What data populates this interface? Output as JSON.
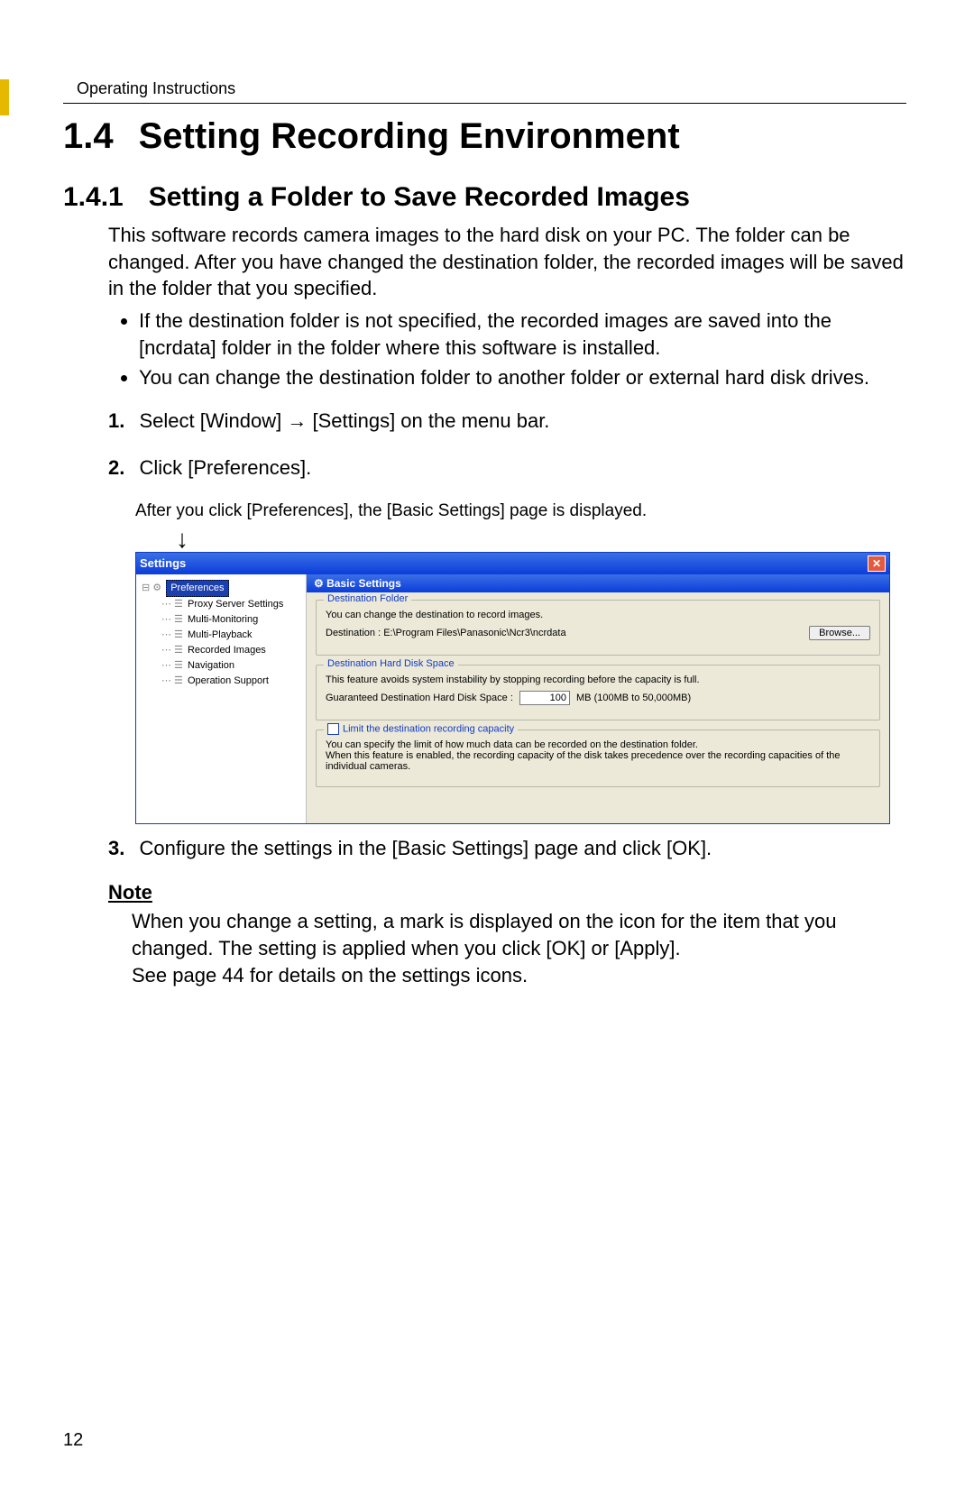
{
  "docHeader": "Operating Instructions",
  "section": {
    "num": "1.4",
    "title": "Setting Recording Environment"
  },
  "subsection": {
    "num": "1.4.1",
    "title": "Setting a Folder to Save Recorded Images"
  },
  "intro": "This software records camera images to the hard disk on your PC. The folder can be changed. After you have changed the destination folder, the recorded images will be saved in the folder that you specified.",
  "bullets": [
    "If the destination folder is not specified, the recorded images are saved into the [ncrdata] folder in the folder where this software is installed.",
    "You can change the destination folder to another folder or external hard disk drives."
  ],
  "step1": {
    "pre": "Select [Window]",
    "arrow": "→",
    "post": "[Settings] on the menu bar."
  },
  "step2": "Click [Preferences].",
  "step2_after": "After you click [Preferences], the [Basic Settings] page is displayed.",
  "step3": "Configure the settings in the [Basic Settings] page and click [OK].",
  "noteHead": "Note",
  "noteBody1": "When you change a setting, a mark is displayed on the icon for the item that you changed. The setting is applied when you click [OK] or [Apply].",
  "noteBody2": "See page 44 for details on the settings icons.",
  "pageNumber": "12",
  "shot": {
    "title": "Settings",
    "tree": {
      "root": "Preferences",
      "children": [
        "Proxy Server Settings",
        "Multi-Monitoring",
        "Multi-Playback",
        "Recorded Images",
        "Navigation",
        "Operation Support"
      ]
    },
    "panelTitle": "Basic Settings",
    "destFolder": {
      "legend": "Destination Folder",
      "line": "You can change the destination to record images.",
      "pathLabel": "Destination : E:\\Program Files\\Panasonic\\Ncr3\\ncrdata",
      "browse": "Browse..."
    },
    "diskSpace": {
      "legend": "Destination Hard Disk Space",
      "line": "This feature avoids system instability by stopping recording before the capacity is full.",
      "label": "Guaranteed Destination Hard Disk Space :",
      "value": "100",
      "unit": "MB  (100MB to 50,000MB)"
    },
    "limit": {
      "legend": "Limit the destination recording capacity",
      "text": "You can specify the limit of how much data can be recorded on the destination folder.\nWhen this feature is enabled, the recording capacity of the disk takes precedence over the recording capacities of the individual cameras."
    }
  }
}
